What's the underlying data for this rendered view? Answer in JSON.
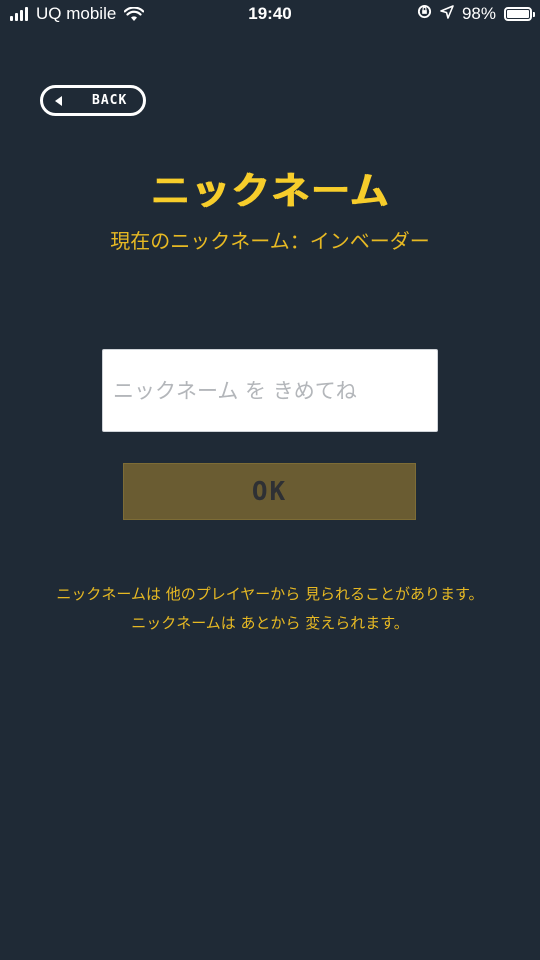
{
  "status_bar": {
    "carrier": "UQ mobile",
    "time": "19:40",
    "battery": "98%",
    "battery_level": 0.98
  },
  "header": {
    "back_label": "BACK",
    "title": "ニックネーム",
    "current_nickname": "現在のニックネーム：インベーダー"
  },
  "form": {
    "input_value": "",
    "input_placeholder": "ニックネーム を きめてね",
    "ok_label": "OK"
  },
  "notices": [
    "ニックネームは 他のプレイヤーから 見られることがあります。",
    "ニックネームは あとから 変えられます。"
  ],
  "colors": {
    "background": "#1f2a36",
    "accent": "#f7cd2b",
    "ok_button": "#6a5c32"
  }
}
